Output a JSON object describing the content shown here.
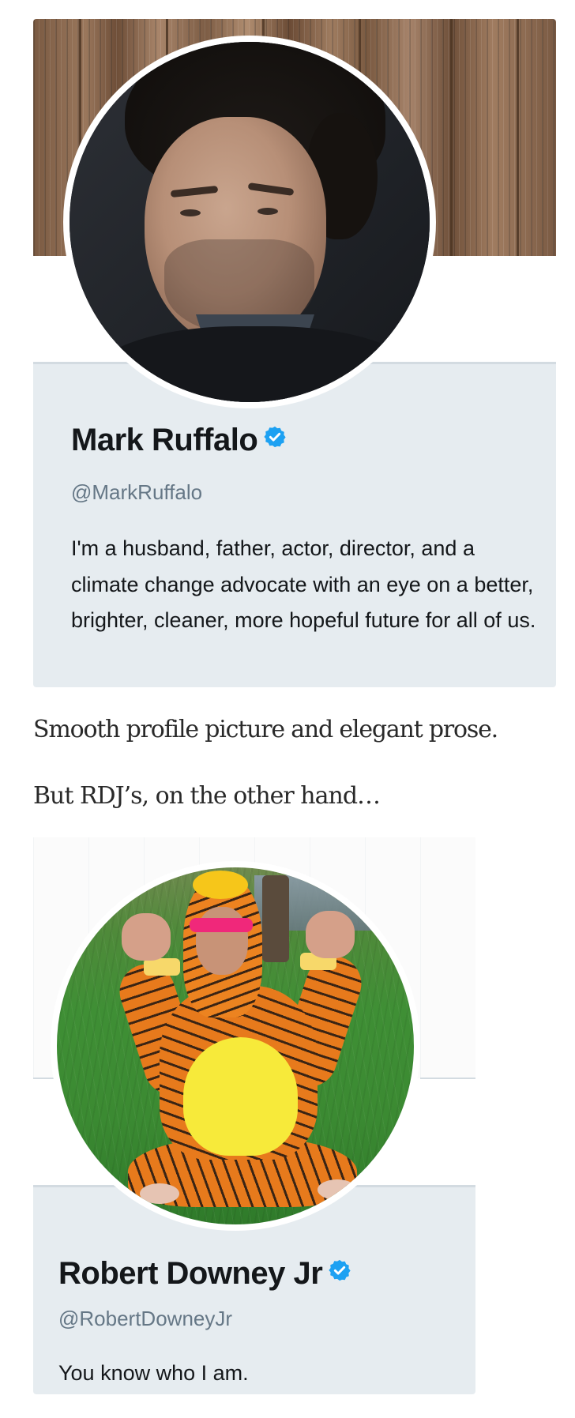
{
  "colors": {
    "verified_badge": "#1da1f2",
    "card_background": "#e6ecf0",
    "handle_text": "#657786",
    "name_text": "#14171a",
    "prose_text": "#292929"
  },
  "profile1": {
    "name": "Mark Ruffalo",
    "verified_icon": "verified-badge-icon",
    "handle": "@MarkRuffalo",
    "bio": "I'm a husband, father, actor, director, and a climate change advocate with an eye on a better, brighter, cleaner, more hopeful future for all of us."
  },
  "prose": {
    "line1": "Smooth profile picture and elegant prose.",
    "line2": "But RDJ’s, on the other hand…"
  },
  "profile2": {
    "name": "Robert Downey Jr",
    "verified_icon": "verified-badge-icon",
    "handle": "@RobertDowneyJr",
    "bio": "You know who I am."
  }
}
